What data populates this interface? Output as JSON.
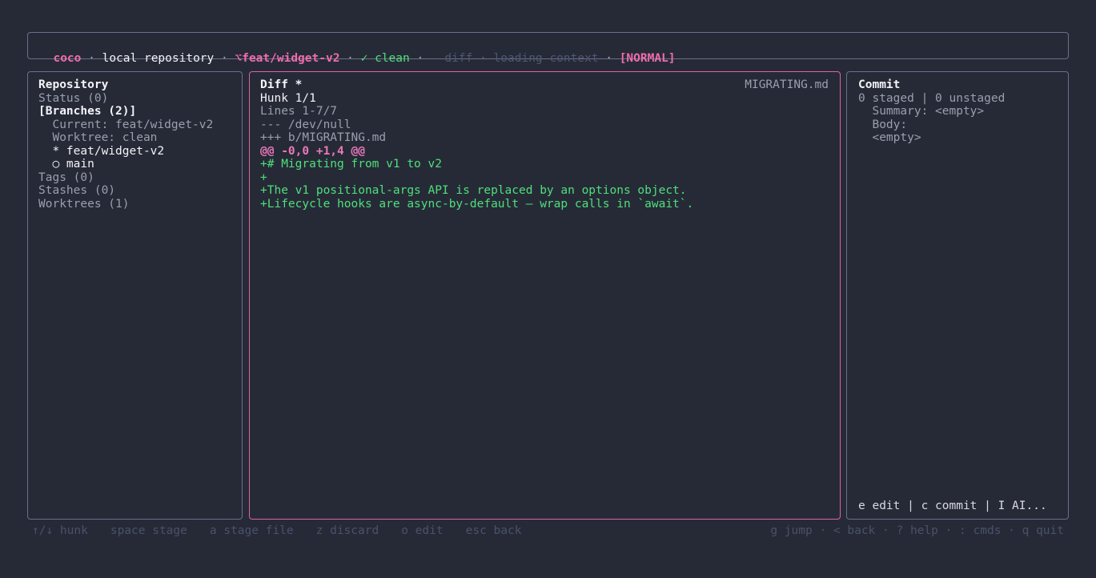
{
  "header": {
    "app": "coco",
    "sep": " · ",
    "repo": "local repository",
    "branch_icon": "⌥",
    "branch": "feat/widget-v2",
    "clean": "✓ clean",
    "view": "diff",
    "context": "loading context",
    "mode": "[NORMAL]"
  },
  "sidebar": {
    "title": "Repository",
    "status": "Status (0)",
    "branches_header": "[Branches (2)]",
    "current": "  Current: feat/widget-v2",
    "worktree": "  Worktree: clean",
    "branch_active": "  * feat/widget-v2",
    "branch_other": "  ○ main",
    "tags": "Tags (0)",
    "stashes": "Stashes (0)",
    "worktrees": "Worktrees (1)"
  },
  "diff": {
    "title": "Diff *",
    "file": "MIGRATING.md",
    "hunk": "Hunk 1/1",
    "lines": "Lines 1-7/7",
    "old_file": "--- /dev/null",
    "new_file": "+++ b/MIGRATING.md",
    "hunk_header": "@@ -0,0 +1,4 @@",
    "added": [
      "+# Migrating from v1 to v2",
      "+",
      "+The v1 positional-args API is replaced by an options object.",
      "+Lifecycle hooks are async-by-default — wrap calls in `await`."
    ]
  },
  "commit": {
    "title": "Commit",
    "counts": "0 staged | 0 unstaged",
    "summary": "  Summary: <empty>",
    "body_label": "  Body:",
    "body_value": "  <empty>",
    "actions": "e edit | c commit | I AI..."
  },
  "footer": {
    "left": [
      "↑/↓ hunk",
      "space stage",
      "a stage file",
      "z discard",
      "o edit",
      "esc back"
    ],
    "right": "g jump · < back · ? help · : cmds · q quit"
  }
}
